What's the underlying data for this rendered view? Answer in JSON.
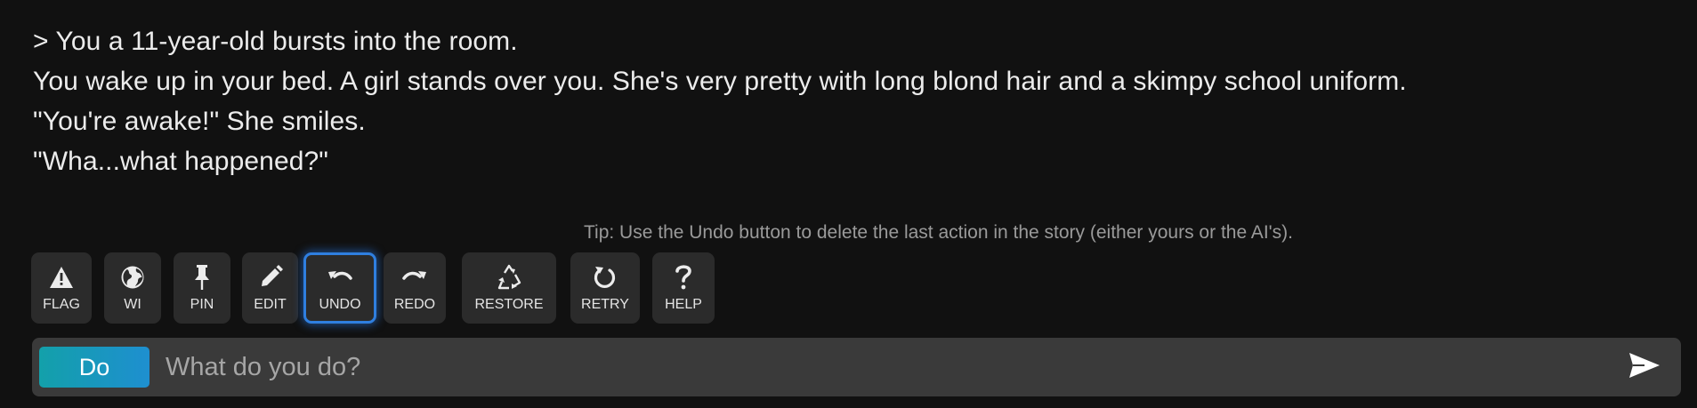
{
  "story": {
    "lines": [
      "> You a 11-year-old bursts into the room.",
      "You wake up in your bed. A girl stands over you. She's very pretty with long blond hair and a skimpy school uniform.",
      "\"You're awake!\" She smiles.",
      "\"Wha...what happened?\""
    ]
  },
  "tip": "Tip: Use the Undo button to delete the last action in the story (either yours or the AI's).",
  "toolbar": {
    "buttons": [
      {
        "label": "FLAG",
        "icon": "warning-icon"
      },
      {
        "label": "WI",
        "icon": "globe-icon"
      },
      {
        "label": "PIN",
        "icon": "pin-icon"
      },
      {
        "label": "EDIT",
        "icon": "pencil-icon"
      },
      {
        "label": "UNDO",
        "icon": "undo-icon",
        "active": true
      },
      {
        "label": "REDO",
        "icon": "redo-icon"
      },
      {
        "label": "RESTORE",
        "icon": "recycle-icon"
      },
      {
        "label": "RETRY",
        "icon": "retry-icon"
      },
      {
        "label": "HELP",
        "icon": "question-icon"
      }
    ]
  },
  "input": {
    "mode_label": "Do",
    "placeholder": "What do you do?",
    "value": "",
    "send_icon": "send-icon"
  },
  "colors": {
    "background": "#111111",
    "button": "#2b2b2b",
    "active_outline": "#2f7fe0",
    "do_gradient_start": "#13a0aa",
    "do_gradient_end": "#1e8fd0"
  }
}
